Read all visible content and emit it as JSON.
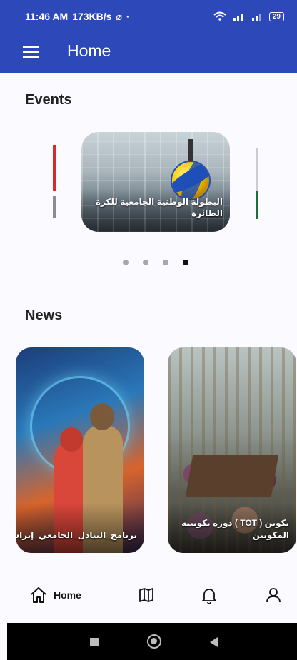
{
  "status_bar": {
    "time": "11:46 AM",
    "speed": "173KB/s",
    "battery": "29"
  },
  "app_bar": {
    "title": "Home"
  },
  "events": {
    "heading": "Events",
    "main_caption": "البطولة الوطنية الجامعية للكرة الطائرة",
    "active_dot": 4
  },
  "news": {
    "heading": "News",
    "items": [
      {
        "caption": "برنامج_التبادل_الجامعي_إيراسموس"
      },
      {
        "caption": "تكوين ( TOT ) دورة تكوينية المكونين"
      }
    ]
  },
  "bottom_nav": {
    "home_label": "Home"
  },
  "colors": {
    "primary": "#2d48b8",
    "background": "#fbfafe"
  }
}
